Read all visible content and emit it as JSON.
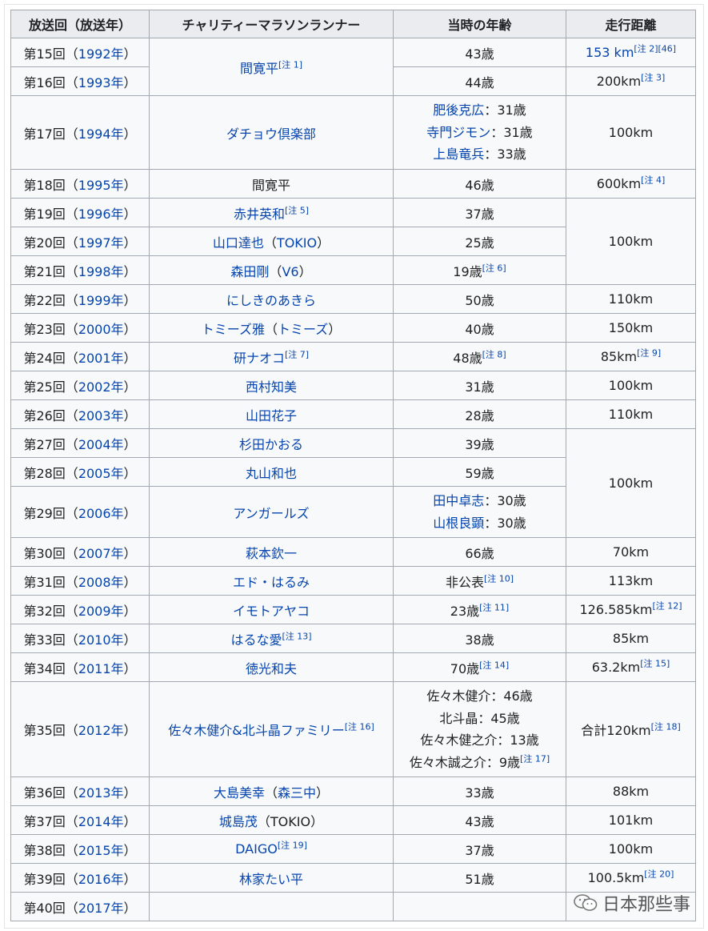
{
  "headers": [
    "放送回（放送年）",
    "チャリティーマラソンランナー",
    "当時の年齢",
    "走行距離"
  ],
  "rows": [
    {
      "ep": "第15回（",
      "year": "1992年",
      "runner": [
        {
          "t": "間寛平",
          "link": true,
          "note": "[注 1]"
        }
      ],
      "age": [
        {
          "t": "43歳"
        }
      ],
      "dist": [
        {
          "t": "153 km",
          "link": true,
          "note": "[注 2][46]"
        }
      ]
    },
    {
      "ep": "第16回（",
      "year": "1993年",
      "age": [
        {
          "t": "44歳"
        }
      ],
      "dist": [
        {
          "t": "200km",
          "note": "[注 3]"
        }
      ]
    },
    {
      "ep": "第17回（",
      "year": "1994年",
      "runner": [
        {
          "t": "ダチョウ倶楽部",
          "link": true
        }
      ],
      "age": [
        {
          "t": "肥後克広",
          "link": true,
          "suffix": "：31歳"
        },
        {
          "t": "寺門ジモン",
          "link": true,
          "suffix": "：31歳"
        },
        {
          "t": "上島竜兵",
          "link": true,
          "suffix": "：33歳"
        }
      ],
      "dist": [
        {
          "t": "100km"
        }
      ]
    },
    {
      "ep": "第18回（",
      "year": "1995年",
      "runner": [
        {
          "t": "間寛平"
        }
      ],
      "age": [
        {
          "t": "46歳"
        }
      ],
      "dist": [
        {
          "t": "600km",
          "note": "[注 4]"
        }
      ]
    },
    {
      "ep": "第19回（",
      "year": "1996年",
      "runner": [
        {
          "t": "赤井英和",
          "link": true,
          "note": "[注 5]"
        }
      ],
      "age": [
        {
          "t": "37歳"
        }
      ],
      "dist": [
        {
          "t": "100km"
        }
      ]
    },
    {
      "ep": "第20回（",
      "year": "1997年",
      "runner": [
        {
          "t": "山口達也",
          "link": true,
          "suffix": "（",
          "t2": "TOKIO",
          "suffix2": "）"
        }
      ],
      "age": [
        {
          "t": "25歳"
        }
      ]
    },
    {
      "ep": "第21回（",
      "year": "1998年",
      "runner": [
        {
          "t": "森田剛",
          "link": true,
          "suffix": "（",
          "t2": "V6",
          "suffix2": "）"
        }
      ],
      "age": [
        {
          "t": "19歳",
          "note": "[注 6]"
        }
      ]
    },
    {
      "ep": "第22回（",
      "year": "1999年",
      "runner": [
        {
          "t": "にしきのあきら",
          "link": true
        }
      ],
      "age": [
        {
          "t": "50歳"
        }
      ],
      "dist": [
        {
          "t": "110km"
        }
      ]
    },
    {
      "ep": "第23回（",
      "year": "2000年",
      "runner": [
        {
          "t": "トミーズ雅",
          "link": true,
          "suffix": "（",
          "t2": "トミーズ",
          "suffix2": "）"
        }
      ],
      "age": [
        {
          "t": "40歳"
        }
      ],
      "dist": [
        {
          "t": "150km"
        }
      ]
    },
    {
      "ep": "第24回（",
      "year": "2001年",
      "runner": [
        {
          "t": "研ナオコ",
          "link": true,
          "note": "[注 7]"
        }
      ],
      "age": [
        {
          "t": "48歳",
          "note": "[注 8]"
        }
      ],
      "dist": [
        {
          "t": "85km",
          "note": "[注 9]"
        }
      ]
    },
    {
      "ep": "第25回（",
      "year": "2002年",
      "runner": [
        {
          "t": "西村知美",
          "link": true
        }
      ],
      "age": [
        {
          "t": "31歳"
        }
      ],
      "dist": [
        {
          "t": "100km"
        }
      ]
    },
    {
      "ep": "第26回（",
      "year": "2003年",
      "runner": [
        {
          "t": "山田花子",
          "link": true
        }
      ],
      "age": [
        {
          "t": "28歳"
        }
      ],
      "dist": [
        {
          "t": "110km"
        }
      ]
    },
    {
      "ep": "第27回（",
      "year": "2004年",
      "runner": [
        {
          "t": "杉田かおる",
          "link": true
        }
      ],
      "age": [
        {
          "t": "39歳"
        }
      ],
      "dist": [
        {
          "t": "100km"
        }
      ]
    },
    {
      "ep": "第28回（",
      "year": "2005年",
      "runner": [
        {
          "t": "丸山和也",
          "link": true
        }
      ],
      "age": [
        {
          "t": "59歳"
        }
      ]
    },
    {
      "ep": "第29回（",
      "year": "2006年",
      "runner": [
        {
          "t": "アンガールズ",
          "link": true
        }
      ],
      "age": [
        {
          "t": "田中卓志",
          "link": true,
          "suffix": "：30歳"
        },
        {
          "t": "山根良顕",
          "link": true,
          "suffix": "：30歳"
        }
      ]
    },
    {
      "ep": "第30回（",
      "year": "2007年",
      "runner": [
        {
          "t": "萩本欽一",
          "link": true
        }
      ],
      "age": [
        {
          "t": "66歳"
        }
      ],
      "dist": [
        {
          "t": "70km"
        }
      ]
    },
    {
      "ep": "第31回（",
      "year": "2008年",
      "runner": [
        {
          "t": "エド・はるみ",
          "link": true
        }
      ],
      "age": [
        {
          "t": "非公表",
          "note": "[注 10]"
        }
      ],
      "dist": [
        {
          "t": "113km"
        }
      ]
    },
    {
      "ep": "第32回（",
      "year": "2009年",
      "runner": [
        {
          "t": "イモトアヤコ",
          "link": true
        }
      ],
      "age": [
        {
          "t": "23歳",
          "note": "[注 11]"
        }
      ],
      "dist": [
        {
          "t": "126.585km",
          "note": "[注 12]"
        }
      ]
    },
    {
      "ep": "第33回（",
      "year": "2010年",
      "runner": [
        {
          "t": "はるな愛",
          "link": true,
          "note": "[注 13]"
        }
      ],
      "age": [
        {
          "t": "38歳"
        }
      ],
      "dist": [
        {
          "t": "85km"
        }
      ]
    },
    {
      "ep": "第34回（",
      "year": "2011年",
      "runner": [
        {
          "t": "徳光和夫",
          "link": true
        }
      ],
      "age": [
        {
          "t": "70歳",
          "note": "[注 14]"
        }
      ],
      "dist": [
        {
          "t": "63.2km",
          "note": "[注 15]"
        }
      ]
    },
    {
      "ep": "第35回（",
      "year": "2012年",
      "runner": [
        {
          "t": "佐々木健介&北斗晶ファミリー",
          "link": true,
          "note": "[注 16]"
        }
      ],
      "age": [
        {
          "t": "佐々木健介：46歳"
        },
        {
          "t": "北斗晶：45歳"
        },
        {
          "t": "佐々木健之介：13歳"
        },
        {
          "t": "佐々木誠之介：9歳",
          "note": "[注 17]"
        }
      ],
      "dist": [
        {
          "t": "合計120km",
          "note": "[注 18]"
        }
      ]
    },
    {
      "ep": "第36回（",
      "year": "2013年",
      "runner": [
        {
          "t": "大島美幸",
          "link": true,
          "suffix": "（",
          "t2": "森三中",
          "suffix2": "）"
        }
      ],
      "age": [
        {
          "t": "33歳"
        }
      ],
      "dist": [
        {
          "t": "88km"
        }
      ]
    },
    {
      "ep": "第37回（",
      "year": "2014年",
      "runner": [
        {
          "t": "城島茂",
          "link": true,
          "suffix": "（TOKIO）"
        }
      ],
      "age": [
        {
          "t": "43歳"
        }
      ],
      "dist": [
        {
          "t": "101km"
        }
      ]
    },
    {
      "ep": "第38回（",
      "year": "2015年",
      "runner": [
        {
          "t": "DAIGO",
          "link": true,
          "note": "[注 19]"
        }
      ],
      "age": [
        {
          "t": "37歳"
        }
      ],
      "dist": [
        {
          "t": "100km"
        }
      ]
    },
    {
      "ep": "第39回（",
      "year": "2016年",
      "runner": [
        {
          "t": "林家たい平",
          "link": true
        }
      ],
      "age": [
        {
          "t": "51歳"
        }
      ],
      "dist": [
        {
          "t": "100.5km",
          "note": "[注 20]"
        }
      ]
    },
    {
      "ep": "第40回（",
      "year": "2017年",
      "runner": [
        {
          "t": ""
        }
      ],
      "age": [
        {
          "t": ""
        }
      ],
      "dist": [
        {
          "t": ""
        }
      ]
    }
  ],
  "close_paren": "）",
  "watermark": "日本那些事"
}
